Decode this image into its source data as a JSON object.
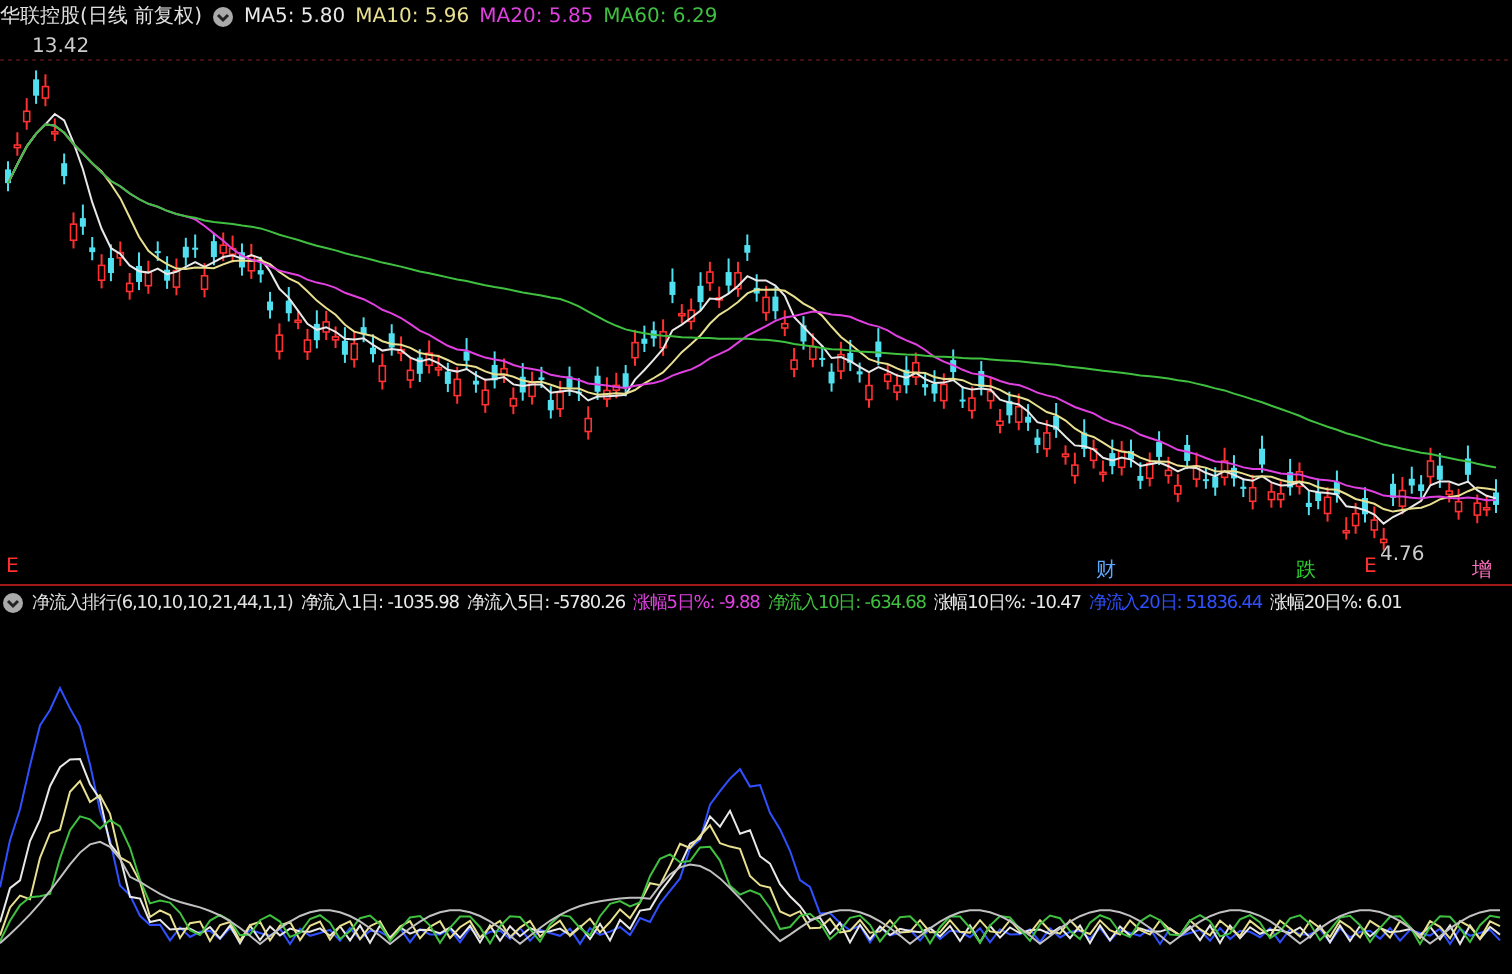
{
  "main_chart": {
    "title": "华联控股(日线 前复权)",
    "ma": [
      {
        "label": "MA5: 5.80",
        "color": "#e8e8e8"
      },
      {
        "label": "MA10: 5.96",
        "color": "#e8e090"
      },
      {
        "label": "MA20: 5.85",
        "color": "#e040e0"
      },
      {
        "label": "MA60: 6.29",
        "color": "#40c040"
      }
    ],
    "high_label": "13.42",
    "low_label": "4.76",
    "markers": [
      {
        "text": "E",
        "color": "#ff3030"
      },
      {
        "text": "财",
        "color": "#60a8ff"
      },
      {
        "text": "跌",
        "color": "#30d030"
      },
      {
        "text": "E",
        "color": "#ff3030"
      },
      {
        "text": "增",
        "color": "#ff70c0"
      }
    ]
  },
  "indicator": {
    "title": "净流入排行(6,10,10,10,21,44,1,1)",
    "values": [
      {
        "label": "净流入1日: -1035.98",
        "color": "#e8e8e8"
      },
      {
        "label": "净流入5日: -5780.26",
        "color": "#e8e8e8"
      },
      {
        "label": "涨幅5日%: -9.88",
        "color": "#e040e0"
      },
      {
        "label": "净流入10日: -634.68",
        "color": "#40c040"
      },
      {
        "label": "涨幅10日%: -10.47",
        "color": "#e8e8e8"
      },
      {
        "label": "净流入20日: 51836.44",
        "color": "#3050ff"
      },
      {
        "label": "涨幅20日%: 6.01",
        "color": "#e8e8e8"
      }
    ]
  }
}
